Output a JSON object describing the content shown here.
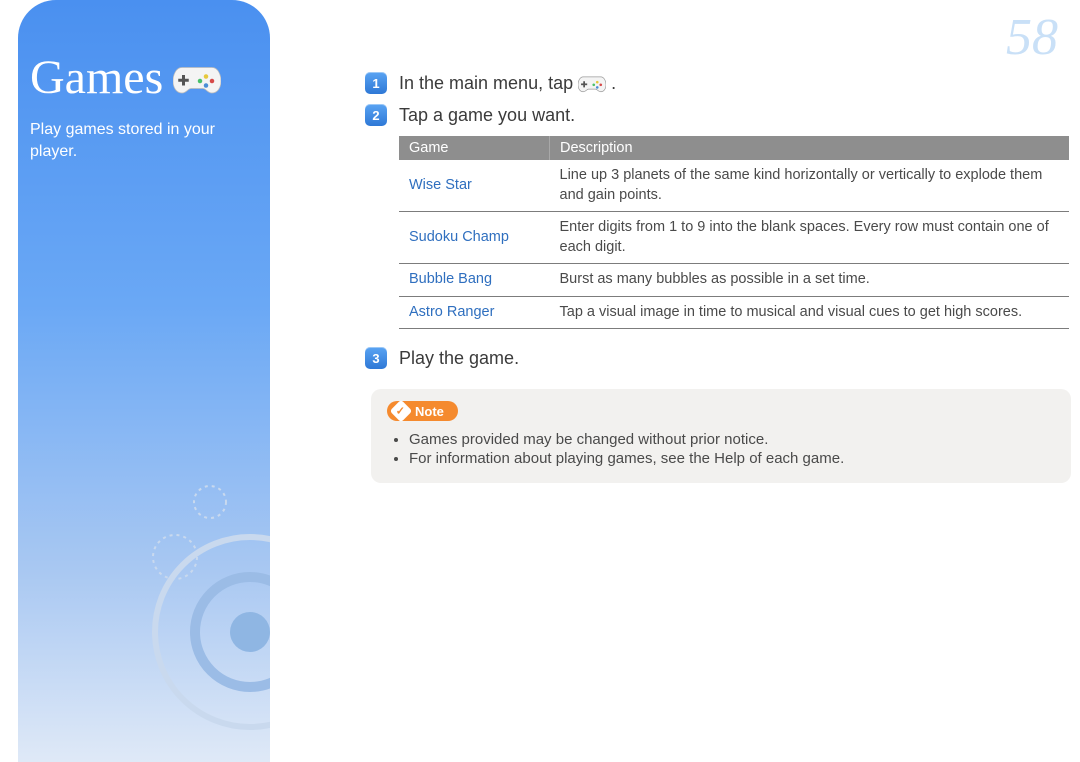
{
  "page_number": "58",
  "sidebar": {
    "title": "Games",
    "subtitle": "Play games stored in your player."
  },
  "steps": {
    "s1_prefix": "In the main menu, tap ",
    "s1_suffix": ".",
    "s2": "Tap a game you want.",
    "s3": "Play the game."
  },
  "table": {
    "headers": {
      "game": "Game",
      "desc": "Description"
    },
    "rows": [
      {
        "name": "Wise Star",
        "desc": "Line up 3 planets of the same kind horizontally or vertically to explode them and gain points."
      },
      {
        "name": "Sudoku Champ",
        "desc": "Enter digits from 1 to 9 into the blank spaces. Every row must contain one of each digit."
      },
      {
        "name": "Bubble Bang",
        "desc": "Burst as many bubbles as possible in a set time."
      },
      {
        "name": "Astro Ranger",
        "desc": "Tap a visual image in time to musical and visual cues to get high scores."
      }
    ]
  },
  "note": {
    "label": "Note",
    "items": [
      "Games provided may be changed without prior notice.",
      "For information about playing games, see the Help of each game."
    ]
  }
}
